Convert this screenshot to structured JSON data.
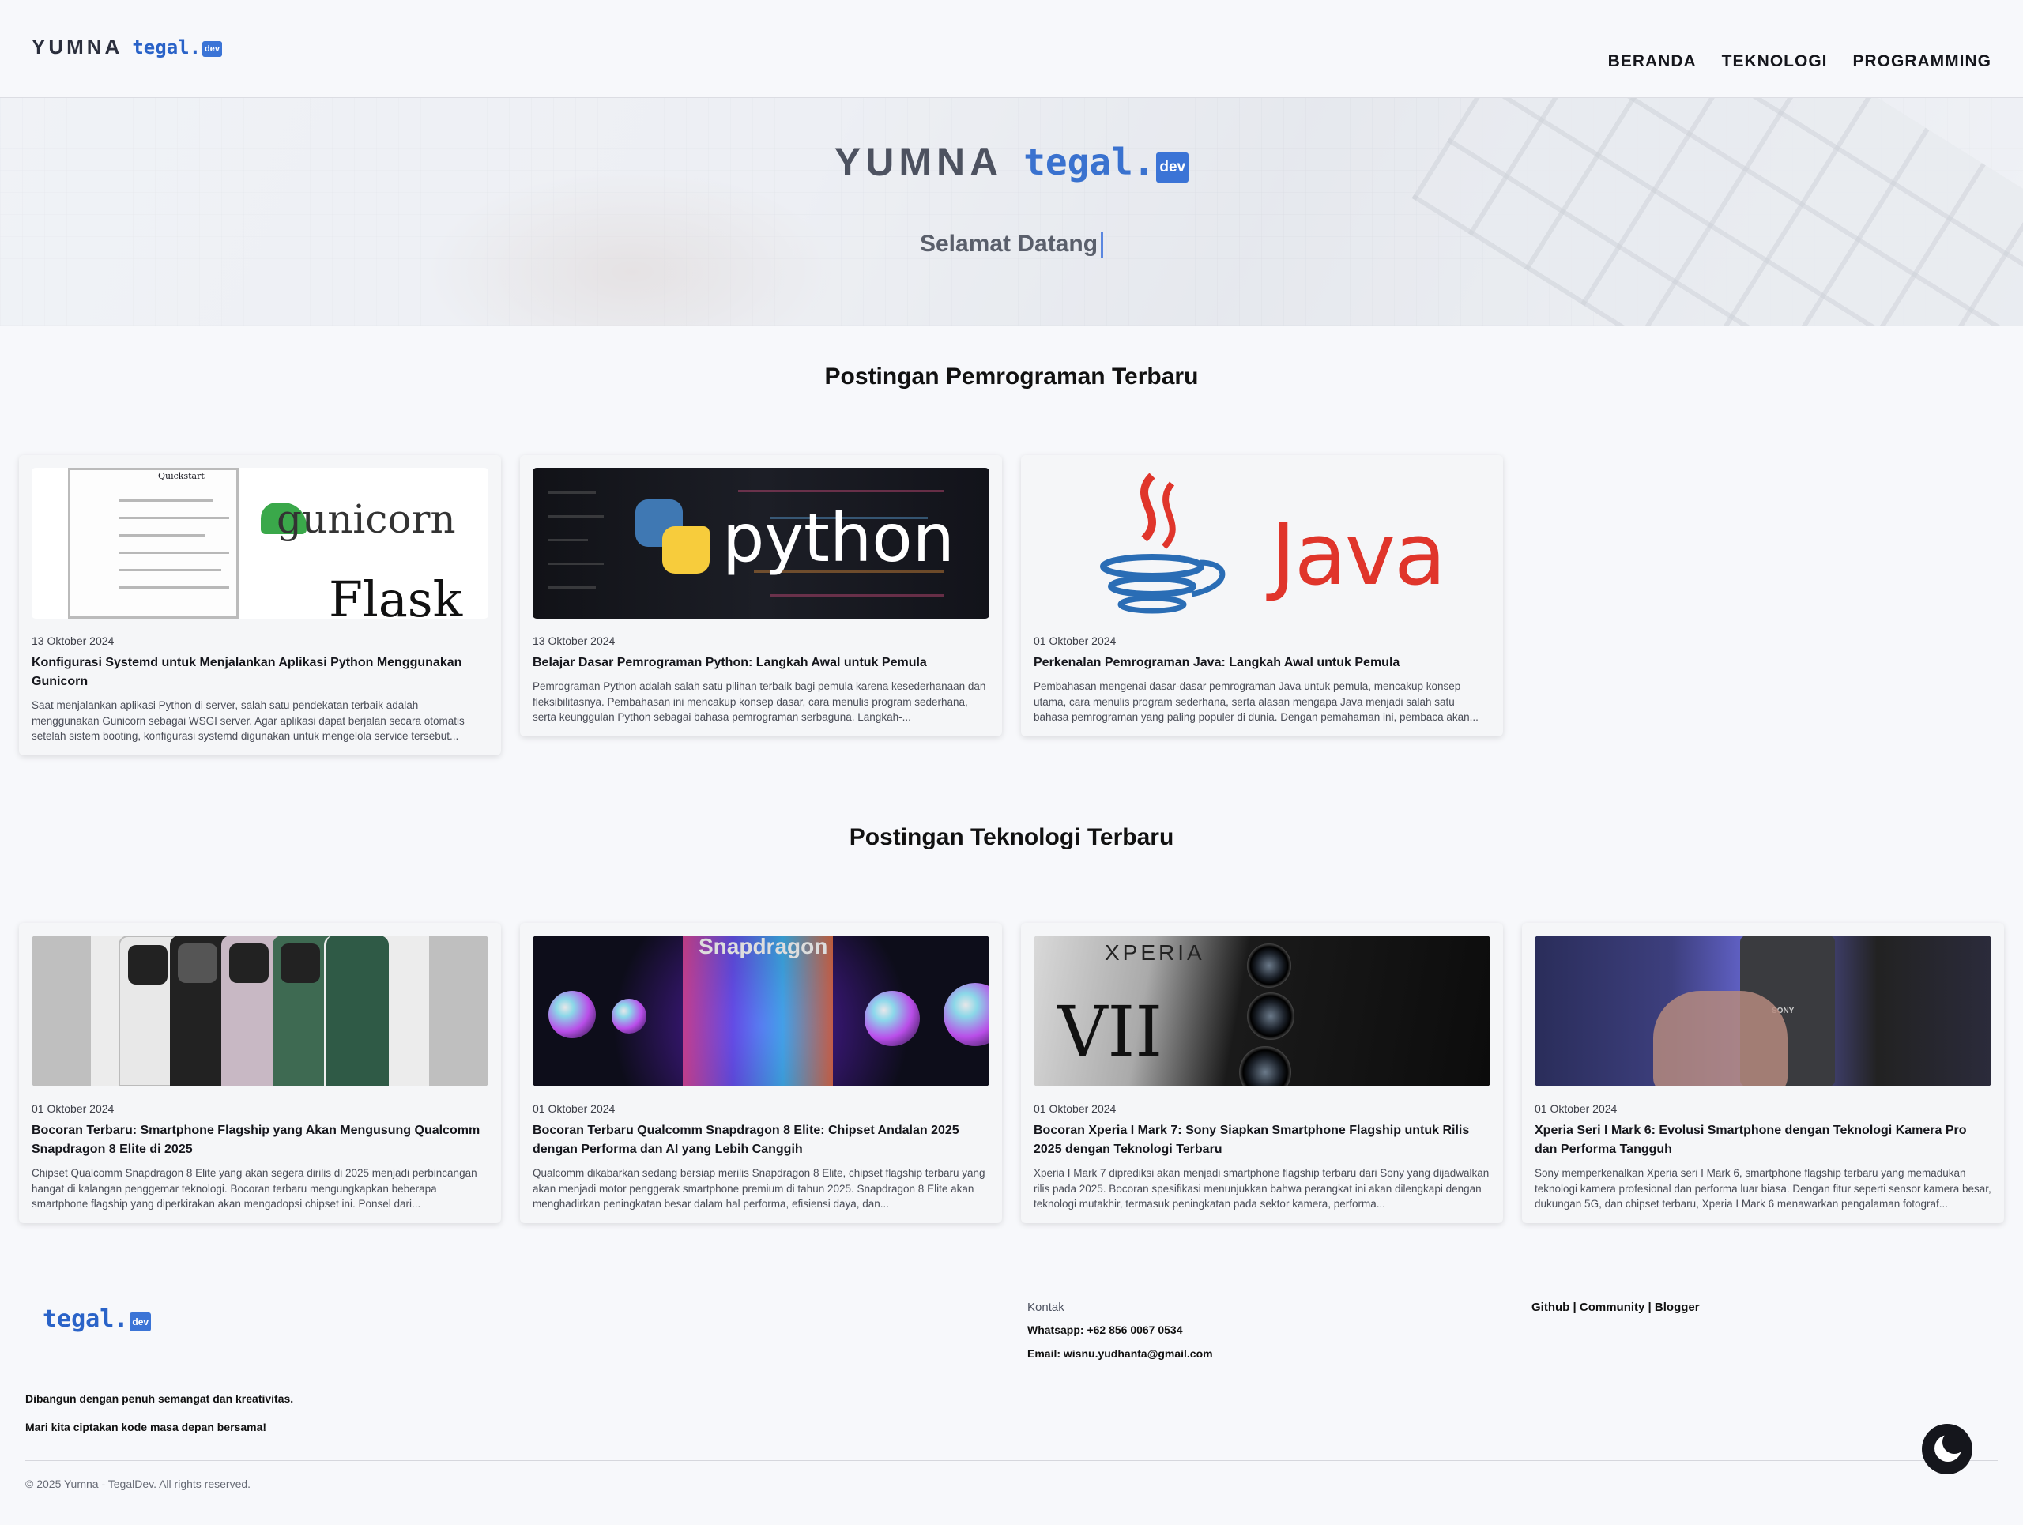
{
  "brand": {
    "yumna": "YUMNA",
    "tegal": "tegal.",
    "dev": "dev"
  },
  "nav": {
    "items": [
      {
        "label": "BERANDA"
      },
      {
        "label": "TEKNOLOGI"
      },
      {
        "label": "PROGRAMMING"
      }
    ]
  },
  "hero": {
    "welcome": "Selamat Datang"
  },
  "programming": {
    "title": "Postingan Pemrograman Terbaru",
    "cards": [
      {
        "date": "13 Oktober 2024",
        "title": "Konfigurasi Systemd untuk Menjalankan Aplikasi Python Menggunakan Gunicorn",
        "excerpt": "Saat menjalankan aplikasi Python di server, salah satu pendekatan terbaik adalah menggunakan Gunicorn sebagai WSGI server. Agar aplikasi dapat berjalan secara otomatis setelah sistem booting, konfigurasi systemd digunakan untuk mengelola service tersebut...",
        "image_text": {
          "doc_title": "Quickstart",
          "gunicorn": "gunicorn",
          "flask": "Flask"
        }
      },
      {
        "date": "13 Oktober 2024",
        "title": "Belajar Dasar Pemrograman Python: Langkah Awal untuk Pemula",
        "excerpt": "Pemrograman Python adalah salah satu pilihan terbaik bagi pemula karena kesederhanaan dan fleksibilitasnya. Pembahasan ini mencakup konsep dasar, cara menulis program sederhana, serta keunggulan Python sebagai bahasa pemrograman serbaguna. Langkah-...",
        "image_text": {
          "python": "python"
        }
      },
      {
        "date": "01 Oktober 2024",
        "title": "Perkenalan Pemrograman Java: Langkah Awal untuk Pemula",
        "excerpt": "Pembahasan mengenai dasar-dasar pemrograman Java untuk pemula, mencakup konsep utama, cara menulis program sederhana, serta alasan mengapa Java menjadi salah satu bahasa pemrograman yang paling populer di dunia. Dengan pemahaman ini, pembaca akan...",
        "image_text": {
          "java": "Java"
        }
      }
    ]
  },
  "technology": {
    "title": "Postingan Teknologi Terbaru",
    "cards": [
      {
        "date": "01 Oktober 2024",
        "title": "Bocoran Terbaru: Smartphone Flagship yang Akan Mengusung Qualcomm Snapdragon 8 Elite di 2025",
        "excerpt": "Chipset Qualcomm Snapdragon 8 Elite yang akan segera dirilis di 2025 menjadi perbincangan hangat di kalangan penggemar teknologi. Bocoran terbaru mengungkapkan beberapa smartphone flagship yang diperkirakan akan mengadopsi chipset ini. Ponsel dari..."
      },
      {
        "date": "01 Oktober 2024",
        "title": "Bocoran Terbaru Qualcomm Snapdragon 8 Elite: Chipset Andalan 2025 dengan Performa dan AI yang Lebih Canggih",
        "excerpt": "Qualcomm dikabarkan sedang bersiap merilis Snapdragon 8 Elite, chipset flagship terbaru yang akan menjadi motor penggerak smartphone premium di tahun 2025. Snapdragon 8 Elite akan menghadirkan peningkatan besar dalam hal performa, efisiensi daya, dan...",
        "image_text": {
          "snapdragon": "Snapdragon"
        }
      },
      {
        "date": "01 Oktober 2024",
        "title": "Bocoran Xperia I Mark 7: Sony Siapkan Smartphone Flagship untuk Rilis 2025 dengan Teknologi Terbaru",
        "excerpt": "Xperia I Mark 7 diprediksi akan menjadi smartphone flagship terbaru dari Sony yang dijadwalkan rilis pada 2025. Bocoran spesifikasi menunjukkan bahwa perangkat ini akan dilengkapi dengan teknologi mutakhir, termasuk peningkatan pada sektor kamera, performa...",
        "image_text": {
          "xperia": "XPERIA",
          "mark": "VII"
        }
      },
      {
        "date": "01 Oktober 2024",
        "title": "Xperia Seri I Mark 6: Evolusi Smartphone dengan Teknologi Kamera Pro dan Performa Tangguh",
        "excerpt": "Sony memperkenalkan Xperia seri I Mark 6, smartphone flagship terbaru yang memadukan teknologi kamera profesional dan performa luar biasa. Dengan fitur seperti sensor kamera besar, dukungan 5G, dan chipset terbaru, Xperia I Mark 6 menawarkan pengalaman fotograf...",
        "image_text": {
          "sony": "SONY"
        }
      }
    ]
  },
  "footer": {
    "tagline1": "Dibangun dengan penuh semangat dan kreativitas.",
    "tagline2": "Mari kita ciptakan kode masa depan bersama!",
    "contact_label": "Kontak",
    "whatsapp": "Whatsapp: +62 856 0067 0534",
    "email": "Email: wisnu.yudhanta@gmail.com",
    "links": [
      {
        "label": "Github"
      },
      {
        "label": "Community"
      },
      {
        "label": "Blogger"
      }
    ],
    "link_separator": " | ",
    "copyright": "© 2025 Yumna - TegalDev. All rights reserved."
  },
  "colors": {
    "accent": "#2a63c8",
    "background": "#f7f8fb",
    "text": "#15161c"
  },
  "icons": {
    "theme_toggle": "moon-icon"
  }
}
